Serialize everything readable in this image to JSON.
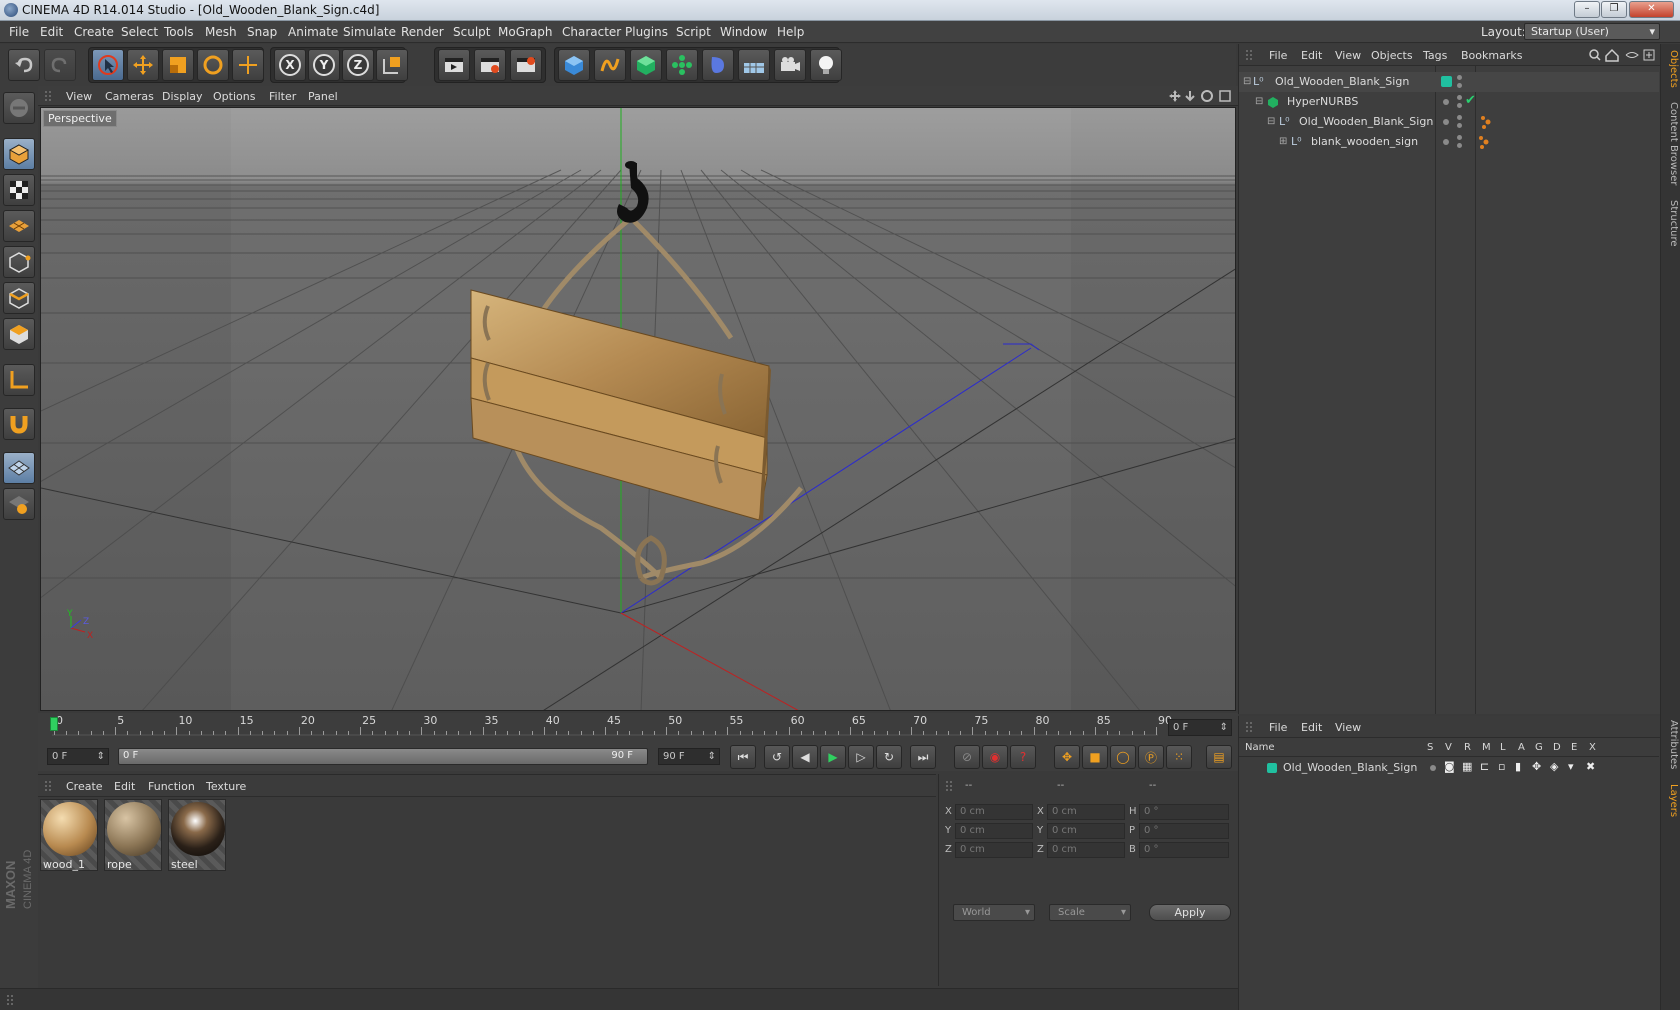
{
  "window": {
    "title": "CINEMA 4D R14.014 Studio - [Old_Wooden_Blank_Sign.c4d]",
    "buttons": [
      "–",
      "❐",
      "✕"
    ]
  },
  "menubar": {
    "items": [
      "File",
      "Edit",
      "Create",
      "Select",
      "Tools",
      "Mesh",
      "Snap",
      "Animate",
      "Simulate",
      "Render",
      "Sculpt",
      "MoGraph",
      "Character",
      "Plugins",
      "Script",
      "Window",
      "Help"
    ],
    "layout_label": "Layout:",
    "layout_value": "Startup (User)"
  },
  "toolbar": {
    "icons": [
      "undo-icon",
      "redo-icon",
      "live-select-icon",
      "move-icon",
      "scale-icon",
      "rotate-icon",
      "add-object-icon",
      "x-axis-icon",
      "y-axis-icon",
      "z-axis-icon",
      "coordinate-system-icon",
      "render-view-icon",
      "render-picture-viewer-icon",
      "render-settings-icon",
      "cube-icon",
      "spline-pen-icon",
      "nurbs-icon",
      "array-icon",
      "deformer-icon",
      "floor-icon",
      "camera-icon",
      "light-icon"
    ],
    "axis_labels": [
      "X",
      "Y",
      "Z"
    ]
  },
  "left_toolbar": {
    "icons": [
      "make-editable-icon",
      "model-mode-icon",
      "texture-mode-icon",
      "workplane-icon",
      "points-mode-icon",
      "edges-mode-icon",
      "polygons-mode-icon",
      "axis-mode-icon",
      "magnet-icon",
      "snap-grid-icon",
      "lock-workplane-icon"
    ]
  },
  "viewport": {
    "menu": [
      "View",
      "Cameras",
      "Display",
      "Options",
      "Filter",
      "Panel"
    ],
    "label": "Perspective",
    "axis": {
      "x": "X",
      "y": "Y",
      "z": "Z"
    }
  },
  "object_manager": {
    "menu": [
      "File",
      "Edit",
      "View",
      "Objects",
      "Tags",
      "Bookmarks"
    ],
    "objects": [
      {
        "name": "Old_Wooden_Blank_Sign",
        "indent": 0
      },
      {
        "name": "HyperNURBS",
        "indent": 1
      },
      {
        "name": "Old_Wooden_Blank_Sign",
        "indent": 2
      },
      {
        "name": "blank_wooden_sign",
        "indent": 3
      }
    ]
  },
  "side_tabs": [
    "Objects",
    "Content Browser",
    "Structure",
    "Attributes",
    "Layers"
  ],
  "timeline": {
    "ticks": [
      "0",
      "5",
      "10",
      "15",
      "20",
      "25",
      "30",
      "35",
      "40",
      "45",
      "50",
      "55",
      "60",
      "65",
      "70",
      "75",
      "80",
      "85",
      "90"
    ],
    "current_frame": "0 F",
    "start_field": "0 F",
    "range_start": "0 F",
    "range_end": "90 F",
    "end_field": "90 F"
  },
  "material_manager": {
    "menu": [
      "Create",
      "Edit",
      "Function",
      "Texture"
    ],
    "materials": [
      "wood_1",
      "rope",
      "steel"
    ]
  },
  "coordinates": {
    "header": [
      "--",
      "--",
      "--"
    ],
    "rows": [
      {
        "a": "X",
        "av": "0 cm",
        "b": "X",
        "bv": "0 cm",
        "c": "H",
        "cv": "0 °"
      },
      {
        "a": "Y",
        "av": "0 cm",
        "b": "Y",
        "bv": "0 cm",
        "c": "P",
        "cv": "0 °"
      },
      {
        "a": "Z",
        "av": "0 cm",
        "b": "Z",
        "bv": "0 cm",
        "c": "B",
        "cv": "0 °"
      }
    ],
    "mode1": "World",
    "mode2": "Scale",
    "apply": "Apply"
  },
  "layer_manager": {
    "menu": [
      "File",
      "Edit",
      "View"
    ],
    "columns": [
      "Name",
      "S",
      "V",
      "R",
      "M",
      "L",
      "A",
      "G",
      "D",
      "E",
      "X"
    ],
    "row": "Old_Wooden_Blank_Sign"
  },
  "branding": "MAXON CINEMA 4D"
}
